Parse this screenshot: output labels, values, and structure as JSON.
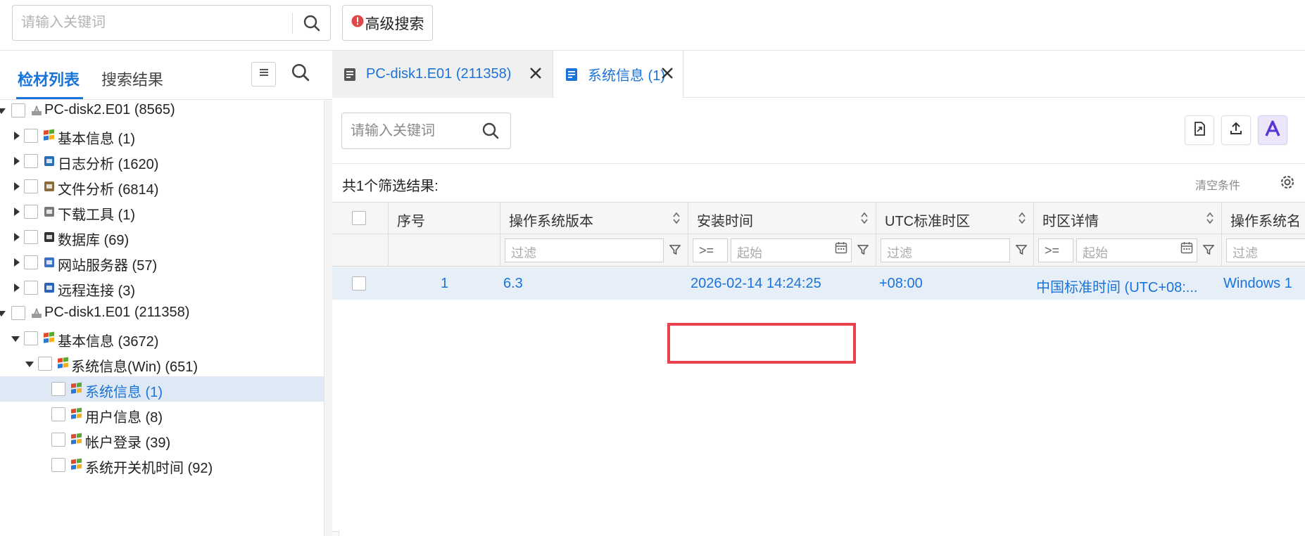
{
  "colors": {
    "accent": "#1a73d9",
    "highlight_box": "#e8434c",
    "selected_row": "#dfe9f6",
    "warn_icon": "#e04848"
  },
  "topbar": {
    "search_placeholder": "请输入关键词",
    "search_icon": "search-icon",
    "advanced_search_label": "高级搜索",
    "advanced_search_icon": "exclamation-circle-icon"
  },
  "left": {
    "tabs": [
      {
        "label": "检材列表",
        "active": true
      },
      {
        "label": "搜索结果",
        "active": false
      }
    ],
    "list_icon": "list-icon",
    "search_icon": "search-icon",
    "tree": [
      {
        "label": "PC-disk2.E01 (8565)",
        "level": 0,
        "expanded": true,
        "icon": "disk-icon"
      },
      {
        "label": "基本信息 (1)",
        "level": 1,
        "expanded": false,
        "icon": "windows-icon"
      },
      {
        "label": "日志分析 (1620)",
        "level": 1,
        "expanded": false,
        "icon": "log-icon"
      },
      {
        "label": "文件分析 (6814)",
        "level": 1,
        "expanded": false,
        "icon": "files-icon"
      },
      {
        "label": "下载工具 (1)",
        "level": 1,
        "expanded": false,
        "icon": "download-icon"
      },
      {
        "label": "数据库 (69)",
        "level": 1,
        "expanded": false,
        "icon": "database-icon"
      },
      {
        "label": "网站服务器 (57)",
        "level": 1,
        "expanded": false,
        "icon": "server-icon"
      },
      {
        "label": "远程连接 (3)",
        "level": 1,
        "expanded": false,
        "icon": "remote-icon"
      },
      {
        "label": "PC-disk1.E01 (211358)",
        "level": 0,
        "expanded": true,
        "icon": "disk-icon"
      },
      {
        "label": "基本信息 (3672)",
        "level": 1,
        "expanded": true,
        "icon": "windows-icon"
      },
      {
        "label": "系统信息(Win) (651)",
        "level": 2,
        "expanded": true,
        "icon": "windows-icon"
      },
      {
        "label": "系统信息 (1)",
        "level": 3,
        "selected": true,
        "icon": "windows-icon"
      },
      {
        "label": "用户信息 (8)",
        "level": 3,
        "icon": "windows-icon"
      },
      {
        "label": "帐户登录 (39)",
        "level": 3,
        "icon": "windows-icon"
      },
      {
        "label": "系统开关机时间 (92)",
        "level": 3,
        "icon": "windows-icon"
      }
    ]
  },
  "doc_tabs": [
    {
      "label": "PC-disk1.E01 (211358)",
      "icon": "document-icon",
      "active": false,
      "close_icon": "close-icon"
    },
    {
      "label": "系统信息 (1)",
      "icon": "document-icon",
      "active": true,
      "close_icon": "close-icon"
    }
  ],
  "content": {
    "search_placeholder": "请输入关键词",
    "toolbar": [
      "export-file-icon",
      "upload-icon",
      "ai-icon"
    ],
    "result_count": "共1个筛选结果:",
    "clear_label": "清空条件",
    "settings_icon": "gear-icon"
  },
  "grid": {
    "columns": [
      "序号",
      "操作系统版本",
      "安装时间",
      "UTC标准时区",
      "时区详情",
      "操作系统名"
    ],
    "filter_placeholder": "过滤",
    "date_op": ">=",
    "date_placeholder": "起始",
    "rows": [
      {
        "index": "1",
        "os_version": "6.3",
        "install_time": "2026-02-14 14:24:25",
        "utc_offset": "+08:00",
        "tz_detail": "中国标准时间 (UTC+08:...",
        "os_name": "Windows 1"
      }
    ]
  }
}
